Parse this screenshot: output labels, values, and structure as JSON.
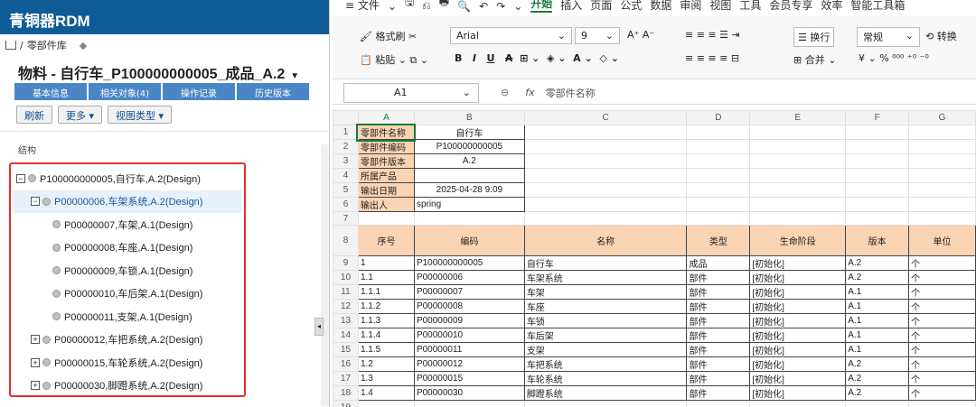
{
  "app": {
    "title": "青铜器RDM"
  },
  "breadcrumb": {
    "sep": "/",
    "item": "零部件库"
  },
  "page": {
    "title": "物料 - 自行车_P100000000005_成品_A.2",
    "dropdown": "▼"
  },
  "tabs": [
    "基本信息",
    "相关对象(4)",
    "操作记录",
    "历史版本"
  ],
  "toolbar": {
    "refresh": "刷新",
    "more": "更多",
    "view_type": "视图类型"
  },
  "structure": {
    "heading": "结构",
    "nodes": [
      {
        "toggle": "−",
        "label": "P100000000005,自行车,A.2(Design)"
      },
      {
        "toggle": "−",
        "label": "P00000006,车架系统,A.2(Design)"
      },
      {
        "toggle": "",
        "label": "P00000007,车架,A.1(Design)"
      },
      {
        "toggle": "",
        "label": "P00000008,车座,A.1(Design)"
      },
      {
        "toggle": "",
        "label": "P00000009,车锁,A.1(Design)"
      },
      {
        "toggle": "",
        "label": "P00000010,车后架,A.1(Design)"
      },
      {
        "toggle": "",
        "label": "P00000011,支架,A.1(Design)"
      },
      {
        "toggle": "+",
        "label": "P00000012,车把系统,A.2(Design)"
      },
      {
        "toggle": "+",
        "label": "P00000015,车轮系统,A.2(Design)"
      },
      {
        "toggle": "+",
        "label": "P00000030,脚蹬系统,A.2(Design)"
      }
    ]
  },
  "excel": {
    "menu": [
      "≡ 文件",
      "⌄",
      "🖫",
      "⎌",
      "🖶",
      "🔍",
      "↶",
      "↷",
      "⌄",
      "开始",
      "插入",
      "页面",
      "公式",
      "数据",
      "审阅",
      "视图",
      "工具",
      "会员专享",
      "效率",
      "智能工具箱"
    ],
    "ribbon": {
      "format_painter": "格式刷",
      "paste": "粘贴",
      "font": "Arial",
      "size": "9",
      "wrap": "换行",
      "number_format": "常规",
      "convert": "转换",
      "merge": "合并",
      "bold": "B",
      "italic": "I",
      "underline": "U",
      "strike": "A",
      "grow": "A⁺",
      "shrink": "A⁻",
      "currency": "¥",
      "percent": "%"
    },
    "namebox": "A1",
    "formula": "零部件名称",
    "columns": [
      "A",
      "B",
      "C",
      "D",
      "E",
      "F",
      "G"
    ],
    "info_rows": [
      {
        "row": "1",
        "label": "零部件名称",
        "value": "自行车"
      },
      {
        "row": "2",
        "label": "零部件编码",
        "value": "P100000000005"
      },
      {
        "row": "3",
        "label": "零部件版本",
        "value": "A.2"
      },
      {
        "row": "4",
        "label": "所属产品",
        "value": ""
      },
      {
        "row": "5",
        "label": "输出日期",
        "value": "2025-04-28 9:09"
      },
      {
        "row": "6",
        "label": "输出人",
        "value": "spring"
      }
    ],
    "blank_row": "7",
    "header_row": {
      "row": "8",
      "cells": [
        "序号",
        "编码",
        "名称",
        "类型",
        "生命阶段",
        "版本",
        "单位"
      ]
    },
    "data_rows": [
      {
        "row": "9",
        "cells": [
          "1",
          "P100000000005",
          "自行车",
          "成品",
          "[初始化]",
          "A.2",
          "个"
        ]
      },
      {
        "row": "10",
        "cells": [
          "1.1",
          "P00000006",
          "车架系统",
          "部件",
          "[初始化]",
          "A.2",
          "个"
        ]
      },
      {
        "row": "11",
        "cells": [
          "1.1.1",
          "P00000007",
          "车架",
          "部件",
          "[初始化]",
          "A.1",
          "个"
        ]
      },
      {
        "row": "12",
        "cells": [
          "1.1.2",
          "P00000008",
          "车座",
          "部件",
          "[初始化]",
          "A.1",
          "个"
        ]
      },
      {
        "row": "13",
        "cells": [
          "1.1.3",
          "P00000009",
          "车锁",
          "部件",
          "[初始化]",
          "A.1",
          "个"
        ]
      },
      {
        "row": "14",
        "cells": [
          "1.1.4",
          "P00000010",
          "车后架",
          "部件",
          "[初始化]",
          "A.1",
          "个"
        ]
      },
      {
        "row": "15",
        "cells": [
          "1.1.5",
          "P00000011",
          "支架",
          "部件",
          "[初始化]",
          "A.1",
          "个"
        ]
      },
      {
        "row": "16",
        "cells": [
          "1.2",
          "P00000012",
          "车把系统",
          "部件",
          "[初始化]",
          "A.2",
          "个"
        ]
      },
      {
        "row": "17",
        "cells": [
          "1.3",
          "P00000015",
          "车轮系统",
          "部件",
          "[初始化]",
          "A.2",
          "个"
        ]
      },
      {
        "row": "18",
        "cells": [
          "1.4",
          "P00000030",
          "脚蹬系统",
          "部件",
          "[初始化]",
          "A.2",
          "个"
        ]
      }
    ],
    "last_row": "19"
  },
  "colors": {
    "brand": "#0f5b96",
    "tab": "#4a86c5",
    "highlight_border": "#e03030",
    "header_fill": "#fbd4b4",
    "active_tab": "#1a7a3c"
  }
}
